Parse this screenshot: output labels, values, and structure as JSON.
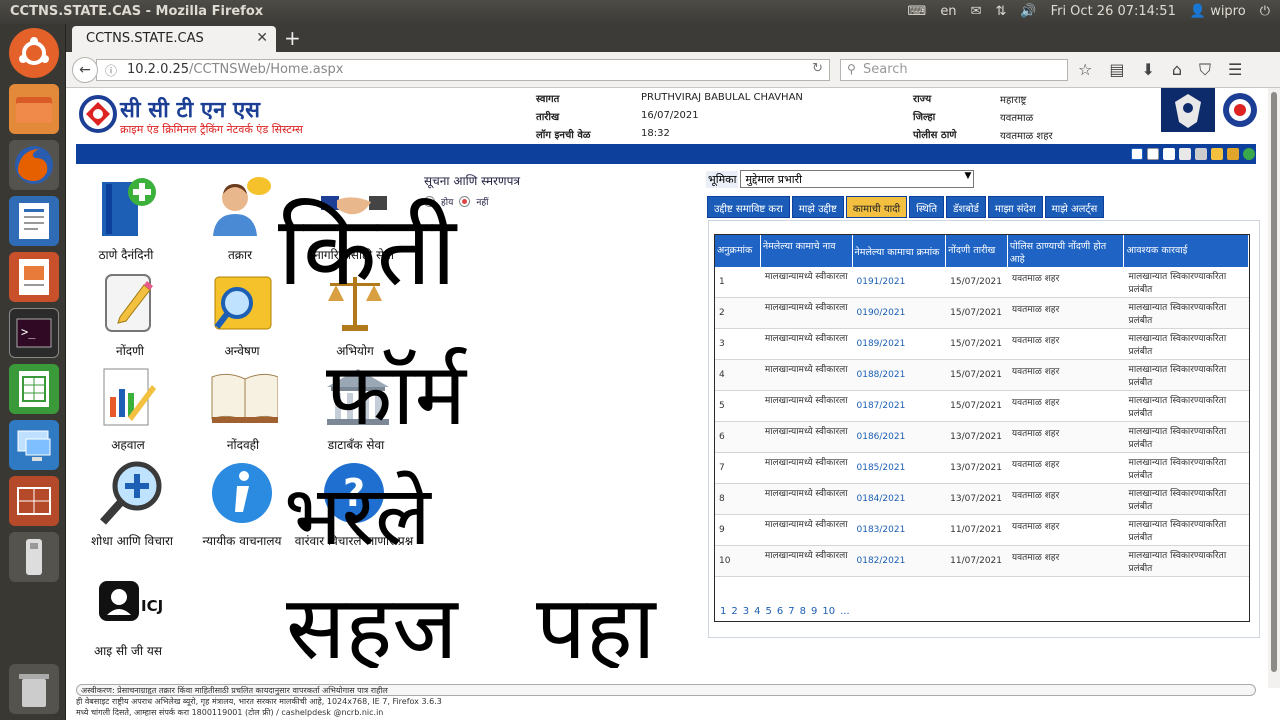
{
  "ubuntu": {
    "window_title": "CCTNS.STATE.CAS - Mozilla Firefox",
    "lang": "en",
    "datetime": "Fri Oct 26 07:14:51",
    "user": "wipro"
  },
  "browser": {
    "tab_title": "CCTNS.STATE.CAS",
    "url_host": "10.2.0.25",
    "url_path": "/CCTNSWeb/Home.aspx",
    "search_placeholder": "Search"
  },
  "header": {
    "logo_title": "सी सी टी एन एस",
    "logo_subtitle": "क्राइम एंड क्रिमिनल ट्रैकिंग नेटवर्क एंड सिस्टम्स",
    "welcome_label": "स्वागत",
    "welcome_value": "PRUTHVIRAJ BABULAL CHAVHAN",
    "date_label": "तारीख",
    "date_value": "16/07/2021",
    "login_label": "लॉग इनची वेळ",
    "login_value": "18:32",
    "state_label": "राज्य",
    "state_value": "महाराष्ट्र",
    "district_label": "जिल्हा",
    "district_value": "यवतमाळ",
    "station_label": "पोलीस ठाणे",
    "station_value": "यवतमाळ शहर"
  },
  "menu": [
    {
      "label": "ठाणे दैनंदिनी",
      "icon": "book-plus-icon"
    },
    {
      "label": "तक्रार",
      "icon": "person-speech-icon"
    },
    {
      "label": "नागरिकांसाठी सेवा",
      "icon": "handshake-icon"
    },
    {
      "label": "नोंदणी",
      "icon": "edit-note-icon"
    },
    {
      "label": "अन्वेषण",
      "icon": "magnifier-folder-icon"
    },
    {
      "label": "अभियोग",
      "icon": "scales-icon"
    },
    {
      "label": "अहवाल",
      "icon": "report-chart-icon"
    },
    {
      "label": "नोंदवही",
      "icon": "open-book-icon"
    },
    {
      "label": "डाटाबँक सेवा",
      "icon": "bank-icon"
    },
    {
      "label": "शोधा आणि विचारा",
      "icon": "search-plus-icon"
    },
    {
      "label": "न्यायीक वाचनालय",
      "icon": "info-icon"
    },
    {
      "label": "वारंवार विचारले जाणारे प्रश्न",
      "icon": "question-icon"
    },
    {
      "label": "आइ सी जी यस",
      "icon": "icjs-logo-icon"
    }
  ],
  "notice": {
    "title": "सूचना आणि स्मरणपत्र",
    "opt_yes": "होय",
    "opt_no": "नहीं"
  },
  "handwriting": [
    "किती",
    "फॉर्म",
    "भरले",
    "सहज",
    "पहा"
  ],
  "role": {
    "label": "भूमिका",
    "value": "मुद्देमाल प्रभारी"
  },
  "tabs": [
    "उद्दीष्ट समाविष्ट करा",
    "माझे उद्दीष्ट",
    "कामाची यादी",
    "स्थिति",
    "डॅशबोर्ड",
    "माझा संदेश",
    "माझे अलर्ट्स"
  ],
  "active_tab": "कामाची यादी",
  "table": {
    "headers": [
      "अनुक्रमांक",
      "नेमलेल्या कामाचे नाव",
      "नेमलेल्या कामाचा क्रमांक",
      "नोंदणी तारीख",
      "पोलिस ठाण्याची नोंदणी होत आहे",
      "आवश्यक कारवाई"
    ],
    "rows": [
      [
        "1",
        "मालखान्यामध्ये स्वीकारला",
        "0191/2021",
        "15/07/2021",
        "यवतमाळ शहर",
        "मालखान्यात स्विकारण्याकरिता प्रलंबीत"
      ],
      [
        "2",
        "मालखान्यामध्ये स्वीकारला",
        "0190/2021",
        "15/07/2021",
        "यवतमाळ शहर",
        "मालखान्यात स्विकारण्याकरिता प्रलंबीत"
      ],
      [
        "3",
        "मालखान्यामध्ये स्वीकारला",
        "0189/2021",
        "15/07/2021",
        "यवतमाळ शहर",
        "मालखान्यात स्विकारण्याकरिता प्रलंबीत"
      ],
      [
        "4",
        "मालखान्यामध्ये स्वीकारला",
        "0188/2021",
        "15/07/2021",
        "यवतमाळ शहर",
        "मालखान्यात स्विकारण्याकरिता प्रलंबीत"
      ],
      [
        "5",
        "मालखान्यामध्ये स्वीकारला",
        "0187/2021",
        "15/07/2021",
        "यवतमाळ शहर",
        "मालखान्यात स्विकारण्याकरिता प्रलंबीत"
      ],
      [
        "6",
        "मालखान्यामध्ये स्वीकारला",
        "0186/2021",
        "13/07/2021",
        "यवतमाळ शहर",
        "मालखान्यात स्विकारण्याकरिता प्रलंबीत"
      ],
      [
        "7",
        "मालखान्यामध्ये स्वीकारला",
        "0185/2021",
        "13/07/2021",
        "यवतमाळ शहर",
        "मालखान्यात स्विकारण्याकरिता प्रलंबीत"
      ],
      [
        "8",
        "मालखान्यामध्ये स्वीकारला",
        "0184/2021",
        "13/07/2021",
        "यवतमाळ शहर",
        "मालखान्यात स्विकारण्याकरिता प्रलंबीत"
      ],
      [
        "9",
        "मालखान्यामध्ये स्वीकारला",
        "0183/2021",
        "11/07/2021",
        "यवतमाळ शहर",
        "मालखान्यात स्विकारण्याकरिता प्रलंबीत"
      ],
      [
        "10",
        "मालखान्यामध्ये स्वीकारला",
        "0182/2021",
        "11/07/2021",
        "यवतमाळ शहर",
        "मालखान्यात स्विकारण्याकरिता प्रलंबीत"
      ]
    ],
    "pages": [
      "1",
      "2",
      "3",
      "4",
      "5",
      "6",
      "7",
      "8",
      "9",
      "10",
      "..."
    ]
  },
  "footer": {
    "scroll_text": "अस्वीकरण: प्रेसाचनाग्राहृत तक्रार किंवा माहितीसाठी प्रचलित कायदानुसार वापरकर्ता अभियोगास पात्र राहील",
    "line1": "ही वेबसाइट राष्ट्रीय अपराध अभिलेख ब्यूरो, गृह मंत्रालय, भारत सरकार मालकीची आहे, 1024x768, IE 7, Firefox 3.6.3",
    "line2": "मध्ये चांगली दिसते, आम्हास संपर्क करा 1800119001 (टोल फ्री) / cashelpdesk @ncrb.nic.in"
  },
  "colors": {
    "accent_blue": "#0d3f9c",
    "table_header": "#1f64c4",
    "active_tab": "#f3c03f"
  }
}
